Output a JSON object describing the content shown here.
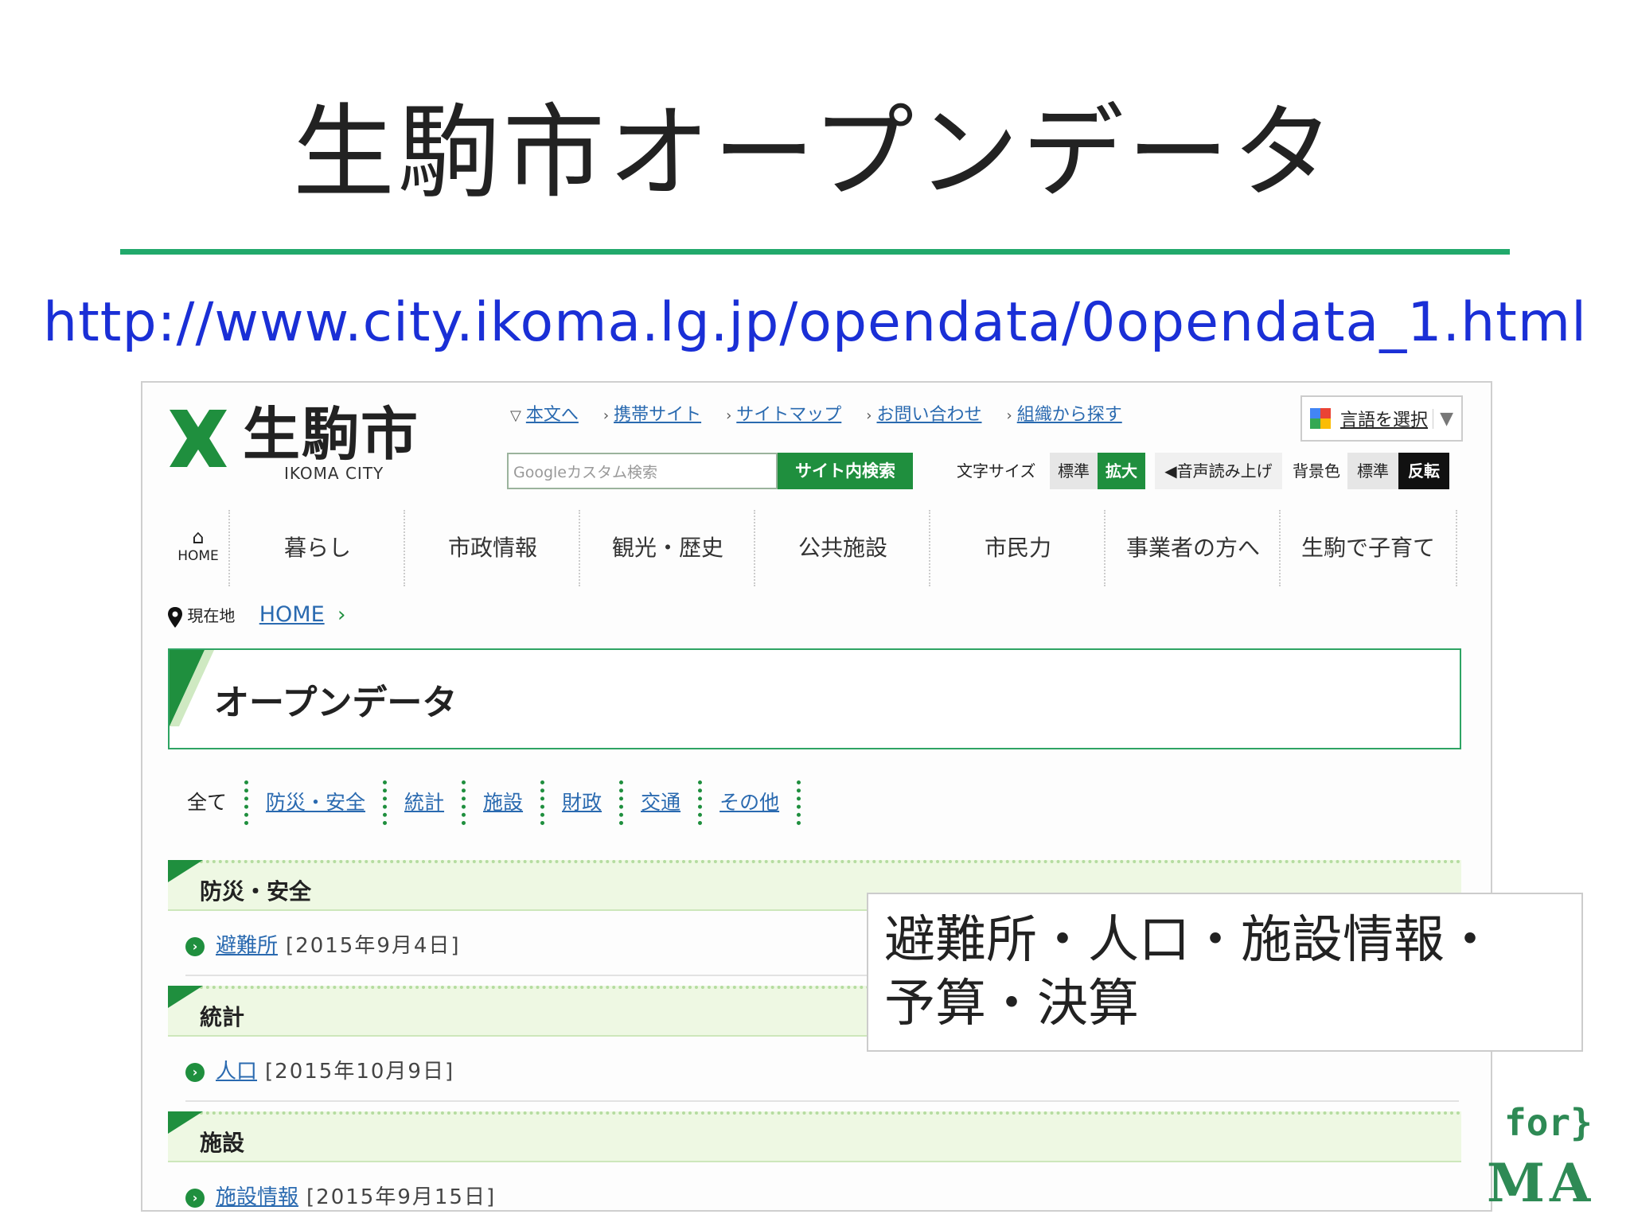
{
  "slide": {
    "title": "生駒市オープンデータ",
    "url": "http://www.city.ikoma.lg.jp/opendata/0opendata_1.html"
  },
  "site": {
    "logo_text": "生駒市",
    "logo_sub": "IKOMA CITY",
    "top_links": [
      "本文へ",
      "携帯サイト",
      "サイトマップ",
      "お問い合わせ",
      "組織から探す"
    ],
    "language_button": "言語を選択",
    "search_placeholder": "Googleカスタム検索",
    "search_button": "サイト内検索",
    "font_size_label": "文字サイズ",
    "font_standard": "標準",
    "font_large": "拡大",
    "read_aloud": "音声読み上げ",
    "bg_color_label": "背景色",
    "bg_standard": "標準",
    "bg_invert": "反転",
    "nav_home": "HOME",
    "nav": [
      "暮らし",
      "市政情報",
      "観光・歴史",
      "公共施設",
      "市民力",
      "事業者の方へ",
      "生駒で子育て"
    ],
    "breadcrumb_label": "現在地",
    "breadcrumb_home": "HOME",
    "page_title": "オープンデータ",
    "categories": [
      "全て",
      "防災・安全",
      "統計",
      "施設",
      "財政",
      "交通",
      "その他"
    ],
    "sections": [
      {
        "title": "防災・安全",
        "item": "避難所",
        "date": "[2015年9月4日]"
      },
      {
        "title": "統計",
        "item": "人口",
        "date": "[2015年10月9日]"
      },
      {
        "title": "施設",
        "item": "施設情報",
        "date": "[2015年9月15日]"
      }
    ]
  },
  "callout": {
    "line1": "避難所・人口・施設情報・",
    "line2": "予算・決算"
  },
  "brand": {
    "line1": "for}",
    "line2": "MA"
  },
  "colors": {
    "accent_green": "#1f8f3e",
    "rule_green": "#21a96b",
    "link_blue": "#2a6ab0",
    "url_blue": "#1a2fd6"
  },
  "icons": [
    "home-icon",
    "location-pin-icon",
    "chevron-right-icon",
    "speaker-icon",
    "google-translate-icon",
    "dropdown-arrow-icon",
    "bullet-arrow-icon"
  ]
}
